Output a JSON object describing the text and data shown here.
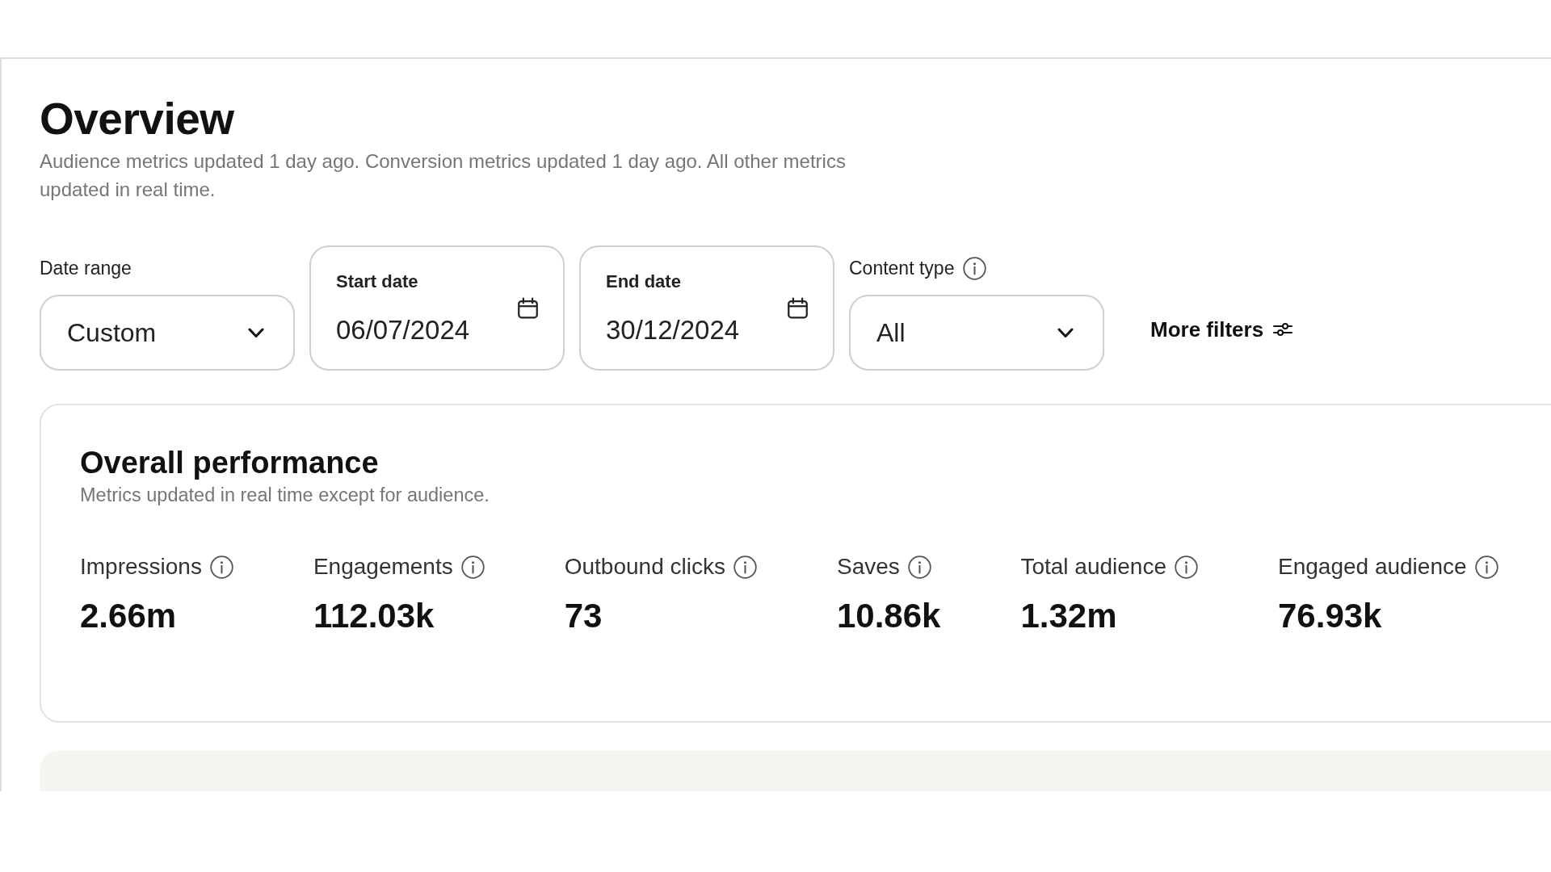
{
  "page": {
    "title": "Overview",
    "subtitle": "Audience metrics updated 1 day ago. Conversion metrics updated 1 day ago. All other metrics updated in real time."
  },
  "filters": [
    {
      "kind": "dropdown",
      "label": "Date range",
      "info": false,
      "value": "Custom"
    },
    {
      "kind": "date",
      "label": "Start date",
      "info": false,
      "value": "06/07/2024"
    },
    {
      "kind": "date",
      "label": "End date",
      "info": false,
      "value": "30/12/2024"
    },
    {
      "kind": "dropdown",
      "label": "Content type",
      "info": true,
      "value": "All"
    }
  ],
  "more_filters": {
    "label": "More filters"
  },
  "overall_performance": {
    "title": "Overall performance",
    "subtitle": "Metrics updated in real time except for audience.",
    "metrics": [
      {
        "label": "Impressions",
        "value": "2.66m"
      },
      {
        "label": "Engagements",
        "value": "112.03k"
      },
      {
        "label": "Outbound clicks",
        "value": "73"
      },
      {
        "label": "Saves",
        "value": "10.86k"
      },
      {
        "label": "Total audience",
        "value": "1.32m"
      },
      {
        "label": "Engaged audience",
        "value": "76.93k"
      }
    ]
  }
}
